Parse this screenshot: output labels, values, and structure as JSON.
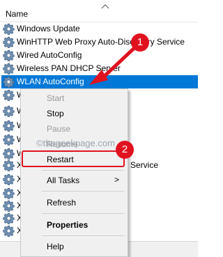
{
  "header": {
    "column_name": "Name"
  },
  "services": [
    {
      "label": "Windows Update"
    },
    {
      "label": "WinHTTP Web Proxy Auto-Discovery Service"
    },
    {
      "label": "Wired AutoConfig"
    },
    {
      "label": "Wireless PAN DHCP Server"
    },
    {
      "label": "WLAN AutoConfig",
      "selected": true
    },
    {
      "label": "W"
    },
    {
      "label": "W"
    },
    {
      "label": "W"
    },
    {
      "label": "W"
    },
    {
      "label": "W"
    },
    {
      "label": "X",
      "suffix": "Service"
    },
    {
      "label": "X"
    },
    {
      "label": "X"
    },
    {
      "label": "X"
    },
    {
      "label": "X"
    },
    {
      "label": "X"
    }
  ],
  "context_menu": {
    "start": "Start",
    "stop": "Stop",
    "pause": "Pause",
    "resume": "Resume",
    "restart": "Restart",
    "all_tasks": "All Tasks",
    "all_tasks_arrow": ">",
    "refresh": "Refresh",
    "properties": "Properties",
    "help": "Help"
  },
  "annotations": {
    "step1": "1",
    "step2": "2"
  },
  "watermark": "©thegeekpage.com",
  "colors": {
    "selection": "#0078d7",
    "annotation": "#e0121f"
  },
  "icons": {
    "service": "gear-icon"
  }
}
